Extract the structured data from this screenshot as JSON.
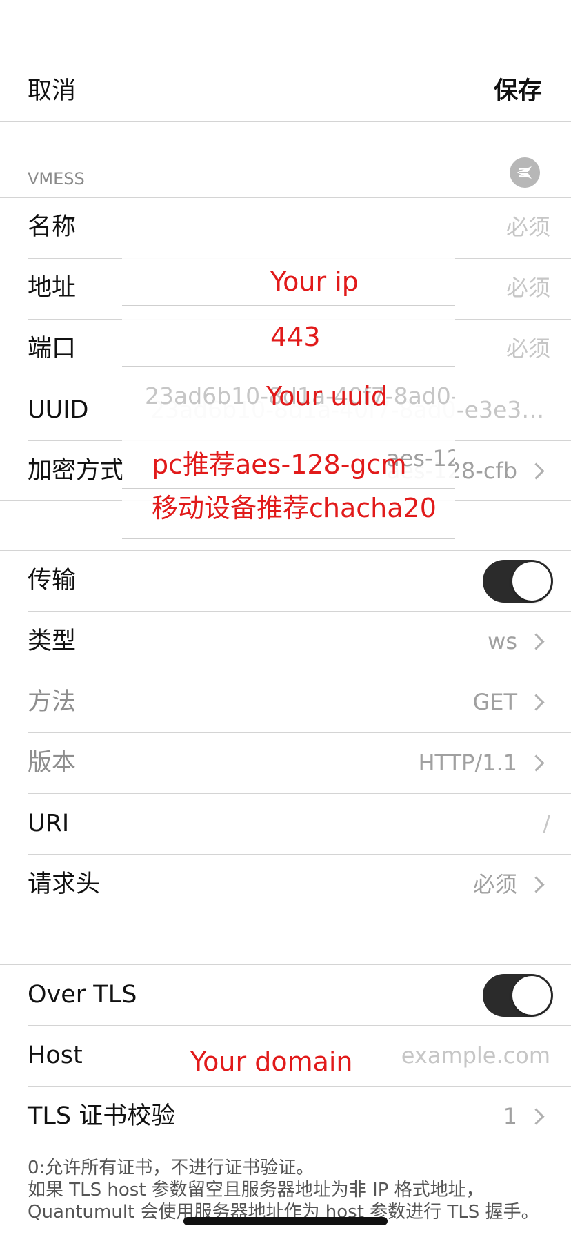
{
  "nav": {
    "cancel": "取消",
    "save": "保存"
  },
  "section_vmess": {
    "title": "VMESS",
    "icon": "send-icon",
    "rows": [
      {
        "key": "name",
        "label": "名称",
        "value": "必须"
      },
      {
        "key": "address",
        "label": "地址",
        "value": "必须"
      },
      {
        "key": "port",
        "label": "端口",
        "value": "必须"
      },
      {
        "key": "uuid",
        "label": "UUID",
        "value": "23ad6b10-8d1a-40f7-8ad0-e3e35c..."
      },
      {
        "key": "encryption",
        "label": "加密方式",
        "value": "aes-128-cfb"
      }
    ]
  },
  "overlay_notes": {
    "ip": "Your ip",
    "port": "443",
    "uuid": "Your uuid",
    "cipher_pc": "pc推荐aes-128-gcm",
    "cipher_mobile": "移动设备推荐chacha20",
    "domain": "Your domain"
  },
  "section_transport": {
    "rows": [
      {
        "key": "transport",
        "label": "传输",
        "toggle_on": true
      },
      {
        "key": "type",
        "label": "类型",
        "value": "ws"
      },
      {
        "key": "method",
        "label": "方法",
        "value": "GET"
      },
      {
        "key": "version",
        "label": "版本",
        "value": "HTTP/1.1"
      },
      {
        "key": "uri",
        "label": "URI",
        "value": "/"
      },
      {
        "key": "headers",
        "label": "请求头",
        "value": "必须"
      }
    ]
  },
  "section_tls": {
    "rows": [
      {
        "key": "over_tls",
        "label": "Over TLS",
        "toggle_on": true
      },
      {
        "key": "host",
        "label": "Host",
        "value": "example.com"
      },
      {
        "key": "tls_verify",
        "label": "TLS 证书校验",
        "value": "1"
      }
    ],
    "footer": [
      "0:允许所有证书，不进行证书验证。",
      "如果 TLS host 参数留空且服务器地址为非 IP 格式地址，",
      "Quantumult 会使用服务器地址作为 host 参数进行 TLS 握手。"
    ]
  },
  "colors": {
    "annotation_red": "#e11a1a",
    "toggle_on": "#2b2b2b",
    "placeholder": "#a0a0a0"
  }
}
